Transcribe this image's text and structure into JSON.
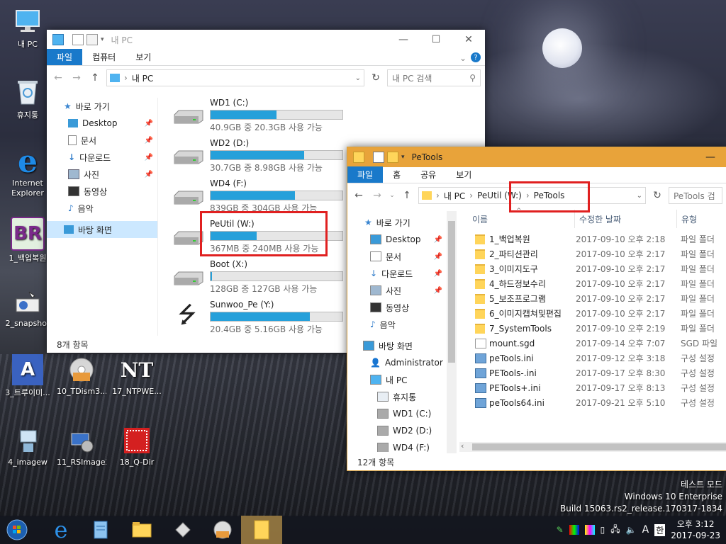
{
  "desktop": {
    "icons": [
      {
        "label": "내 PC",
        "icon": "computer-icon"
      },
      {
        "label": "휴지통",
        "icon": "recycle-bin-icon"
      },
      {
        "label": "Internet Explorer",
        "icon": "ie-icon"
      },
      {
        "label": "1_백업복원",
        "icon": "br-icon",
        "glyph": "BR"
      },
      {
        "label": "2_snapshot",
        "icon": "snapshot-icon"
      },
      {
        "label": "3_트루이미...",
        "icon": "true-image-icon",
        "glyph": "A"
      },
      {
        "label": "10_TDism3...",
        "icon": "disc-icon"
      },
      {
        "label": "17_NTPWE...",
        "icon": "ntpwedit-icon",
        "glyph": "NT"
      },
      {
        "label": "4_imagew",
        "icon": "imagew-icon"
      },
      {
        "label": "11_RSImageX",
        "icon": "rsimagex-icon"
      },
      {
        "label": "18_Q-Dir",
        "icon": "qdir-icon"
      }
    ]
  },
  "win1": {
    "title": "내 PC",
    "tabs": [
      "파일",
      "컴퓨터",
      "보기"
    ],
    "address": "내 PC",
    "search_placeholder": "내 PC 검색",
    "nav": {
      "quick_access": "바로 가기",
      "items": [
        "Desktop",
        "문서",
        "다운로드",
        "사진",
        "동영상",
        "음악"
      ],
      "desktop": "바탕 화면"
    },
    "drives": [
      {
        "name": "WD1 (C:)",
        "size": "40.9GB 중 20.3GB 사용 가능",
        "used": 0.5
      },
      {
        "name": "WD2 (D:)",
        "size": "30.7GB 중 8.98GB 사용 가능",
        "used": 0.71
      },
      {
        "name": "WD4 (F:)",
        "size": "839GB 중 304GB 사용 가능",
        "used": 0.64
      },
      {
        "name": "PeUtil (W:)",
        "size": "367MB 중 240MB 사용 가능",
        "used": 0.35
      },
      {
        "name": "Boot (X:)",
        "size": "128GB 중 127GB 사용 가능",
        "used": 0.01
      },
      {
        "name": "Sunwoo_Pe (Y:)",
        "size": "20.4GB 중 5.16GB 사용 가능",
        "used": 0.75
      }
    ],
    "status": "8개 항목"
  },
  "win2": {
    "title": "PeTools",
    "tabs": [
      "파일",
      "홈",
      "공유",
      "보기"
    ],
    "breadcrumb": [
      "내 PC",
      "PeUtil (W:)",
      "PeTools"
    ],
    "search_placeholder": "PeTools 검",
    "columns": {
      "name": "이름",
      "date": "수정한 날짜",
      "type": "유형"
    },
    "nav": [
      "바로 가기",
      "Desktop",
      "문서",
      "다운로드",
      "사진",
      "동영상",
      "음악",
      "바탕 화면",
      "Administrator",
      "내 PC",
      "휴지통",
      "WD1 (C:)",
      "WD2 (D:)",
      "WD4 (F:)"
    ],
    "files": [
      {
        "name": "1_백업복원",
        "date": "2017-09-10 오후 2:18",
        "type": "파일 폴더",
        "kind": "folder"
      },
      {
        "name": "2_파티션관리",
        "date": "2017-09-10 오후 2:17",
        "type": "파일 폴더",
        "kind": "folder"
      },
      {
        "name": "3_이미지도구",
        "date": "2017-09-10 오후 2:17",
        "type": "파일 폴더",
        "kind": "folder"
      },
      {
        "name": "4_하드정보수리",
        "date": "2017-09-10 오후 2:17",
        "type": "파일 폴더",
        "kind": "folder"
      },
      {
        "name": "5_보조프로그램",
        "date": "2017-09-10 오후 2:17",
        "type": "파일 폴더",
        "kind": "folder"
      },
      {
        "name": "6_이미지캡쳐및편집",
        "date": "2017-09-10 오후 2:17",
        "type": "파일 폴더",
        "kind": "folder"
      },
      {
        "name": "7_SystemTools",
        "date": "2017-09-10 오후 2:19",
        "type": "파일 폴더",
        "kind": "folder"
      },
      {
        "name": "mount.sgd",
        "date": "2017-09-14 오후 7:07",
        "type": "SGD 파일",
        "kind": "doc"
      },
      {
        "name": "peTools.ini",
        "date": "2017-09-12 오후 3:18",
        "type": "구성 설정",
        "kind": "cfg"
      },
      {
        "name": "PETools-.ini",
        "date": "2017-09-17 오후 8:30",
        "type": "구성 설정",
        "kind": "cfg"
      },
      {
        "name": "PETools+.ini",
        "date": "2017-09-17 오후 8:13",
        "type": "구성 설정",
        "kind": "cfg"
      },
      {
        "name": "peTools64.ini",
        "date": "2017-09-21 오후 5:10",
        "type": "구성 설정",
        "kind": "cfg"
      }
    ],
    "status": "12개 항목"
  },
  "watermark": {
    "line1": "테스트 모드",
    "line2": "Windows 10 Enterprise",
    "line3": "Build 15063.rs2_release.170317-1834"
  },
  "taskbar": {
    "time": "오후 3:12",
    "date": "2017-09-23",
    "ime": "A",
    "ime2": "한"
  }
}
